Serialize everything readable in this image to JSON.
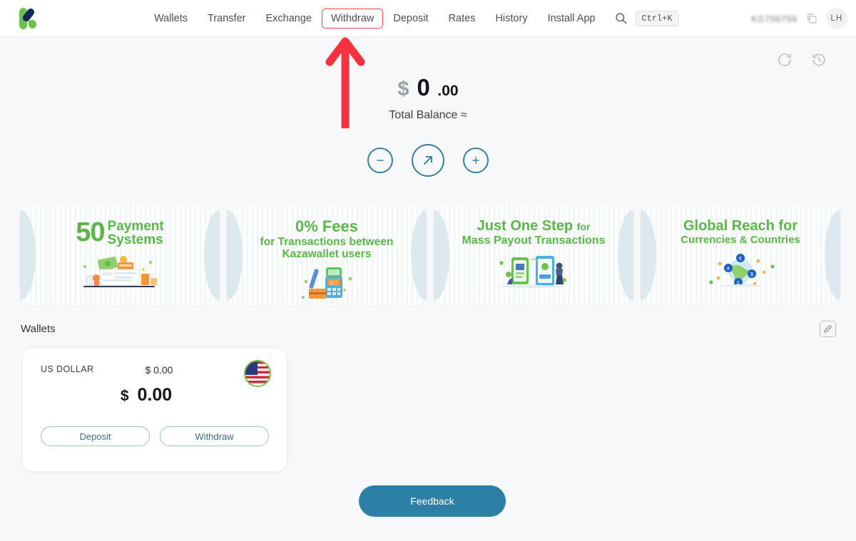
{
  "app": {
    "logo_name": "kazawallet-logo"
  },
  "header": {
    "nav_items": [
      {
        "label": "Wallets",
        "name": "nav-wallets",
        "highlighted": false
      },
      {
        "label": "Transfer",
        "name": "nav-transfer",
        "highlighted": false
      },
      {
        "label": "Exchange",
        "name": "nav-exchange",
        "highlighted": false
      },
      {
        "label": "Withdraw",
        "name": "nav-withdraw",
        "highlighted": true
      },
      {
        "label": "Deposit",
        "name": "nav-deposit",
        "highlighted": false
      },
      {
        "label": "Rates",
        "name": "nav-rates",
        "highlighted": false
      },
      {
        "label": "History",
        "name": "nav-history",
        "highlighted": false
      },
      {
        "label": "Install App",
        "name": "nav-install-app",
        "highlighted": false
      }
    ],
    "search_icon": "search-icon",
    "shortcut_badge": "Ctrl+K",
    "user_id": "KS706756",
    "copy_icon": "copy-icon",
    "avatar_initials": "LH"
  },
  "toolbar": {
    "refresh_icon": "refresh-icon",
    "history_icon": "history-clock-icon"
  },
  "balance": {
    "currency_symbol": "$",
    "integer": "0",
    "decimals": ".00",
    "label": "Total Balance ≈",
    "actions": [
      {
        "name": "withdraw-circle-button",
        "icon": "minus-icon",
        "size": "small"
      },
      {
        "name": "transfer-circle-button",
        "icon": "arrow-up-right-icon",
        "size": "big"
      },
      {
        "name": "deposit-circle-button",
        "icon": "plus-icon",
        "size": "small"
      }
    ]
  },
  "banners": [
    {
      "name": "banner-payment-systems",
      "number": "50",
      "word1": "Payment",
      "word2": "Systems",
      "art": "money-and-cards-illustration"
    },
    {
      "name": "banner-zero-fees",
      "line1": "0% Fees",
      "line2": "for Transactions between",
      "line3": "Kazawallet users",
      "art": "pos-terminal-illustration"
    },
    {
      "name": "banner-mass-payout",
      "line1": "Just One Step",
      "line1_small": "for",
      "line2": "Mass Payout Transactions",
      "art": "people-with-phones-illustration"
    },
    {
      "name": "banner-global-reach",
      "line1": "Global Reach for",
      "line2": "Currencies & Countries",
      "art": "globe-network-illustration"
    }
  ],
  "wallets_section": {
    "title": "Wallets",
    "edit_icon": "edit-pencil-icon"
  },
  "wallet_card": {
    "currency_name": "US DOLLAR",
    "secondary_amount": "$ 0.00",
    "flag": "us-flag-icon",
    "big_symbol": "$",
    "big_amount": "0.00",
    "deposit_label": "Deposit",
    "withdraw_label": "Withdraw"
  },
  "feedback": {
    "label": "Feedback"
  },
  "annotation": {
    "arrow_color": "#f5333f",
    "arrow_target": "nav-withdraw",
    "highlight_box_color": "#ef4444"
  },
  "colors": {
    "brand_green": "#6cc24a",
    "brand_navy": "#16275c",
    "accent_teal": "#2c7fa5",
    "page_bg": "#f7f8f9"
  }
}
